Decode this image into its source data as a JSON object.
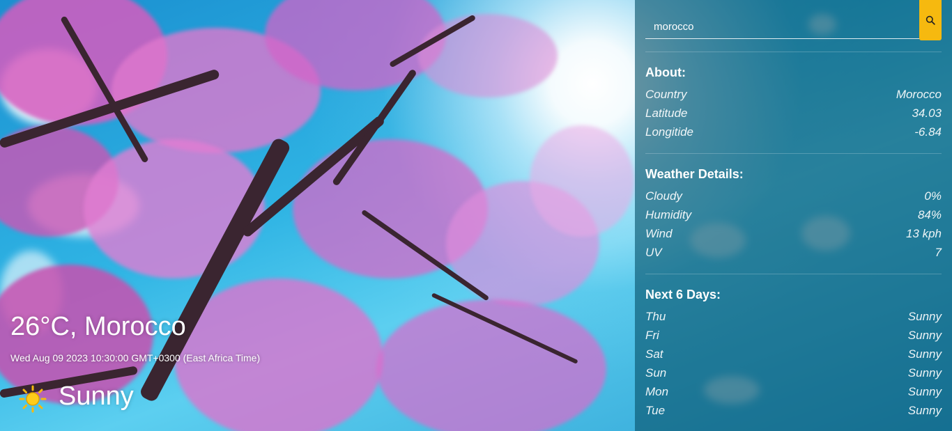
{
  "search": {
    "value": "morocco",
    "button_icon": "search-icon"
  },
  "colors": {
    "accent": "#f6b90f",
    "sidebar_bg": "#065069"
  },
  "about": {
    "title": "About:",
    "rows": [
      {
        "label": "Country",
        "value": "Morocco"
      },
      {
        "label": "Latitude",
        "value": "34.03"
      },
      {
        "label": "Longitide",
        "value": "-6.84"
      }
    ]
  },
  "weather_details": {
    "title": "Weather Details:",
    "rows": [
      {
        "label": "Cloudy",
        "value": "0%"
      },
      {
        "label": "Humidity",
        "value": "84%"
      },
      {
        "label": "Wind",
        "value": "13 kph"
      },
      {
        "label": "UV",
        "value": "7"
      }
    ]
  },
  "forecast": {
    "title": "Next 6 Days:",
    "days": [
      {
        "day": "Thu",
        "condition": "Sunny"
      },
      {
        "day": "Fri",
        "condition": "Sunny"
      },
      {
        "day": "Sat",
        "condition": "Sunny"
      },
      {
        "day": "Sun",
        "condition": "Sunny"
      },
      {
        "day": "Mon",
        "condition": "Sunny"
      },
      {
        "day": "Tue",
        "condition": "Sunny"
      }
    ]
  },
  "current": {
    "title": "26°C, Morocco",
    "datetime": "Wed Aug 09 2023 10:30:00 GMT+0300 (East Africa Time)",
    "condition": "Sunny",
    "condition_icon": "sun-icon"
  }
}
